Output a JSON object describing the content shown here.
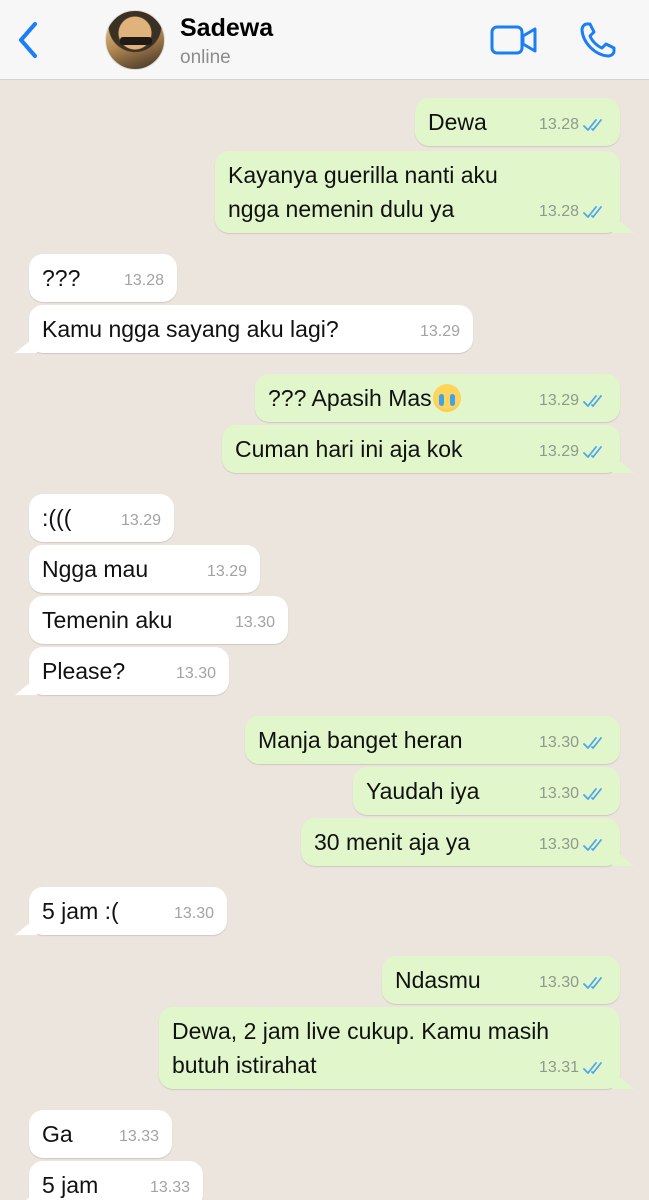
{
  "header": {
    "name": "Sadewa",
    "status": "online",
    "back_icon": "chevron-left-icon",
    "video_icon": "video-camera-icon",
    "call_icon": "phone-icon",
    "accent_color": "#1a7ef5"
  },
  "messages": [
    {
      "dir": "out",
      "text": "Dewa",
      "time": "13.28",
      "read": true
    },
    {
      "dir": "out",
      "text": "Kayanya guerilla nanti aku ngga nemenin dulu ya",
      "time": "13.28",
      "read": true
    },
    {
      "dir": "in",
      "text": "???",
      "time": "13.28"
    },
    {
      "dir": "in",
      "text": "Kamu ngga sayang aku lagi?",
      "time": "13.29"
    },
    {
      "dir": "out",
      "text": "??? Apasih Mas",
      "emoji": "loudly-crying-face",
      "time": "13.29",
      "read": true
    },
    {
      "dir": "out",
      "text": "Cuman hari ini aja kok",
      "time": "13.29",
      "read": true
    },
    {
      "dir": "in",
      "text": ":(((",
      "time": "13.29"
    },
    {
      "dir": "in",
      "text": "Ngga mau",
      "time": "13.29"
    },
    {
      "dir": "in",
      "text": "Temenin aku",
      "time": "13.30"
    },
    {
      "dir": "in",
      "text": "Please?",
      "time": "13.30"
    },
    {
      "dir": "out",
      "text": "Manja banget heran",
      "time": "13.30",
      "read": true
    },
    {
      "dir": "out",
      "text": "Yaudah iya",
      "time": "13.30",
      "read": true
    },
    {
      "dir": "out",
      "text": "30 menit aja ya",
      "time": "13.30",
      "read": true
    },
    {
      "dir": "in",
      "text": "5 jam :(",
      "time": "13.30"
    },
    {
      "dir": "out",
      "text": "Ndasmu",
      "time": "13.30",
      "read": true
    },
    {
      "dir": "out",
      "text": "Dewa, 2 jam live cukup. Kamu masih butuh istirahat",
      "time": "13.31",
      "read": true
    },
    {
      "dir": "in",
      "text": "Ga",
      "time": "13.33"
    },
    {
      "dir": "in",
      "text": "5 jam",
      "time": "13.33"
    }
  ]
}
